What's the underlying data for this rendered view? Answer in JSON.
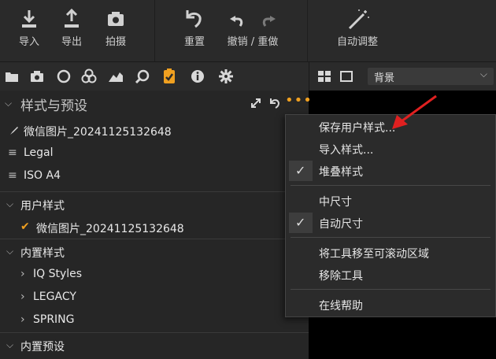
{
  "toolbar": {
    "import": "导入",
    "export": "导出",
    "capture": "拍摄",
    "reset": "重置",
    "undo_redo": "撤销 / 重做",
    "auto_adjust": "自动调整"
  },
  "tabs": [
    "library",
    "camera",
    "color-wheel",
    "color-balance",
    "exposure",
    "search",
    "styles-clipboard",
    "info",
    "gear"
  ],
  "viewer": {
    "layer_select": "背景"
  },
  "panel": {
    "title": "样式与预设",
    "items": [
      {
        "label": "微信图片_20241125132648"
      },
      {
        "label": "Legal"
      },
      {
        "label": "ISO A4"
      }
    ],
    "user_styles": {
      "heading": "用户样式",
      "items": [
        {
          "label": "微信图片_20241125132648"
        }
      ]
    },
    "builtin_styles": {
      "heading": "内置样式",
      "items": [
        {
          "label": "IQ Styles"
        },
        {
          "label": "LEGACY"
        },
        {
          "label": "SPRING"
        }
      ]
    },
    "builtin_presets": {
      "heading": "内置预设"
    }
  },
  "menu": {
    "save_user_style": "保存用户样式...",
    "import_style": "导入样式...",
    "stack_styles": "堆叠样式",
    "medium_size": "中尺寸",
    "auto_size": "自动尺寸",
    "move_tool": "将工具移至可滚动区域",
    "remove_tool": "移除工具",
    "online_help": "在线帮助"
  },
  "colors": {
    "accent": "#f0a020",
    "arrow": "#e02020",
    "background": "#262626"
  }
}
